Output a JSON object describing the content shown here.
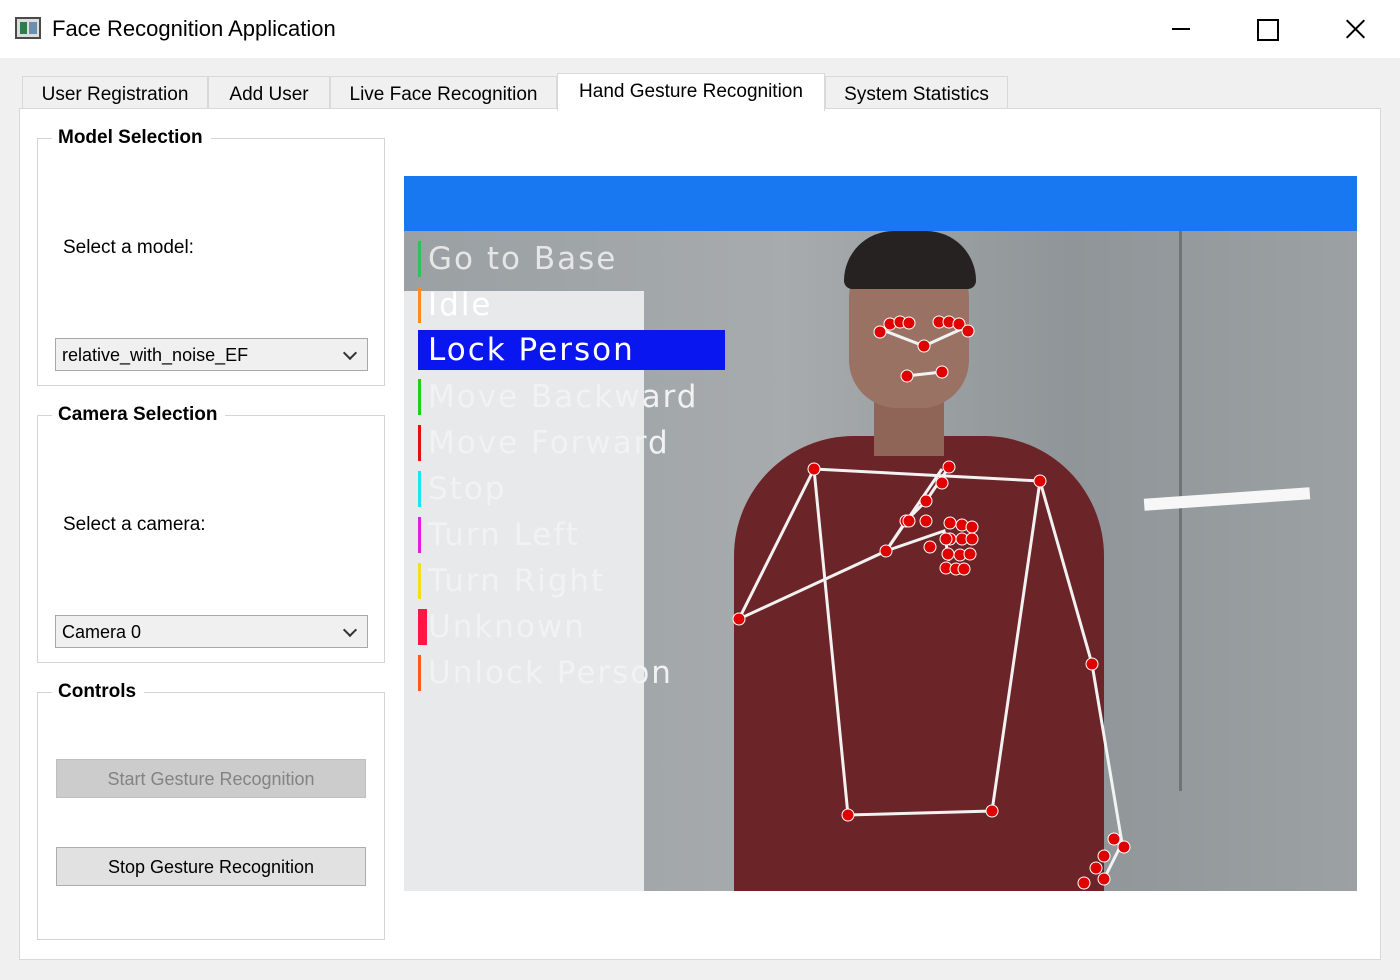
{
  "window": {
    "title": "Face Recognition Application",
    "icon": "app-window-icon"
  },
  "tabs": [
    {
      "label": "User Registration",
      "active": false
    },
    {
      "label": "Add User",
      "active": false
    },
    {
      "label": "Live Face Recognition",
      "active": false
    },
    {
      "label": "Hand Gesture Recognition",
      "active": true
    },
    {
      "label": "System Statistics",
      "active": false
    }
  ],
  "model_selection": {
    "title": "Model Selection",
    "label": "Select a model:",
    "selected": "relative_with_noise_EF"
  },
  "camera_selection": {
    "title": "Camera Selection",
    "label": "Select a camera:",
    "selected": "Camera 0"
  },
  "controls": {
    "title": "Controls",
    "start_label": "Start Gesture Recognition",
    "stop_label": "Stop Gesture Recognition"
  },
  "gestures": [
    {
      "label": "Go to Base",
      "color": "#30c060",
      "text_color": "#e6e6e6",
      "active": false
    },
    {
      "label": "Idle",
      "color": "#ff8c1a",
      "text_color": "#ffffff",
      "active": false
    },
    {
      "label": "Lock Person",
      "color": "#0a16f0",
      "text_color": "#ffffff",
      "active": true
    },
    {
      "label": "Move Backward",
      "color": "#19d219",
      "text_color": "#f2f2f2",
      "active": false
    },
    {
      "label": "Move Forward",
      "color": "#e01010",
      "text_color": "#f2f2f2",
      "active": false
    },
    {
      "label": "Stop",
      "color": "#19e6f0",
      "text_color": "#f2f2f2",
      "active": false
    },
    {
      "label": "Turn Left",
      "color": "#e01ee0",
      "text_color": "#f2f2f2",
      "active": false
    },
    {
      "label": "Turn Right",
      "color": "#f0e019",
      "text_color": "#f2f2f2",
      "active": false
    },
    {
      "label": "Unknown",
      "color": "#ff1744",
      "text_color": "#f2f2f2",
      "active": false
    },
    {
      "label": "Unlock Person",
      "color": "#ff5a1a",
      "text_color": "#f2f2f2",
      "active": false
    }
  ]
}
